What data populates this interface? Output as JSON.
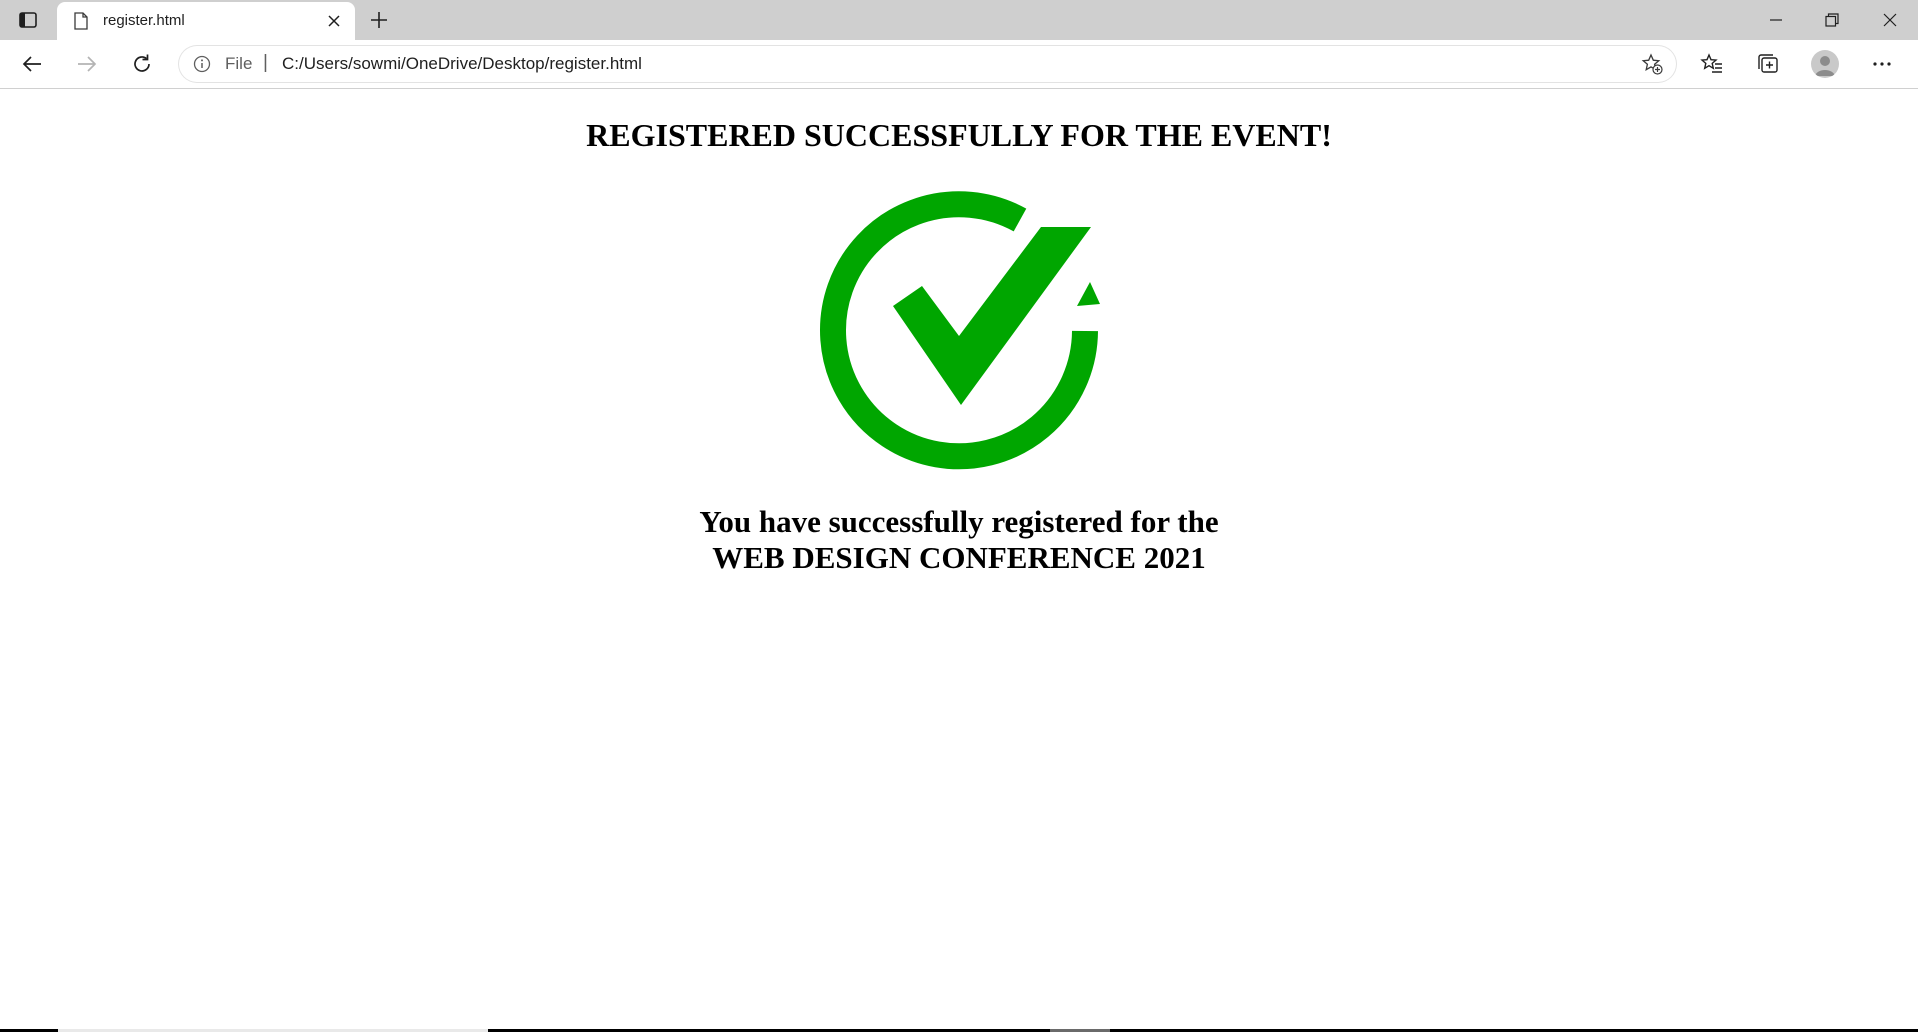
{
  "browser": {
    "tab": {
      "title": "register.html"
    },
    "address_bar": {
      "scheme_label": "File",
      "separator": "|",
      "url": "C:/Users/sowmi/OneDrive/Desktop/register.html"
    },
    "icons": {
      "tab_actions": "tab-actions-icon",
      "favicon": "page-icon",
      "tab_close": "close-icon",
      "new_tab": "plus-icon",
      "minimize": "minimize-icon",
      "maximize": "restore-icon",
      "window_close": "close-icon",
      "back": "arrow-left-icon",
      "forward": "arrow-right-icon",
      "reload": "reload-icon",
      "site_info": "info-icon",
      "add_favorite": "star-plus-icon",
      "favorites": "favorites-icon",
      "collections": "collections-icon",
      "profile": "avatar-icon",
      "more": "more-icon"
    }
  },
  "page": {
    "heading": "REGISTERED SUCCESSFULLY FOR THE EVENT!",
    "message_line_1": "You have successfully registered for the",
    "message_line_2": "WEB DESIGN CONFERENCE 2021",
    "check_color": "#00a600"
  }
}
